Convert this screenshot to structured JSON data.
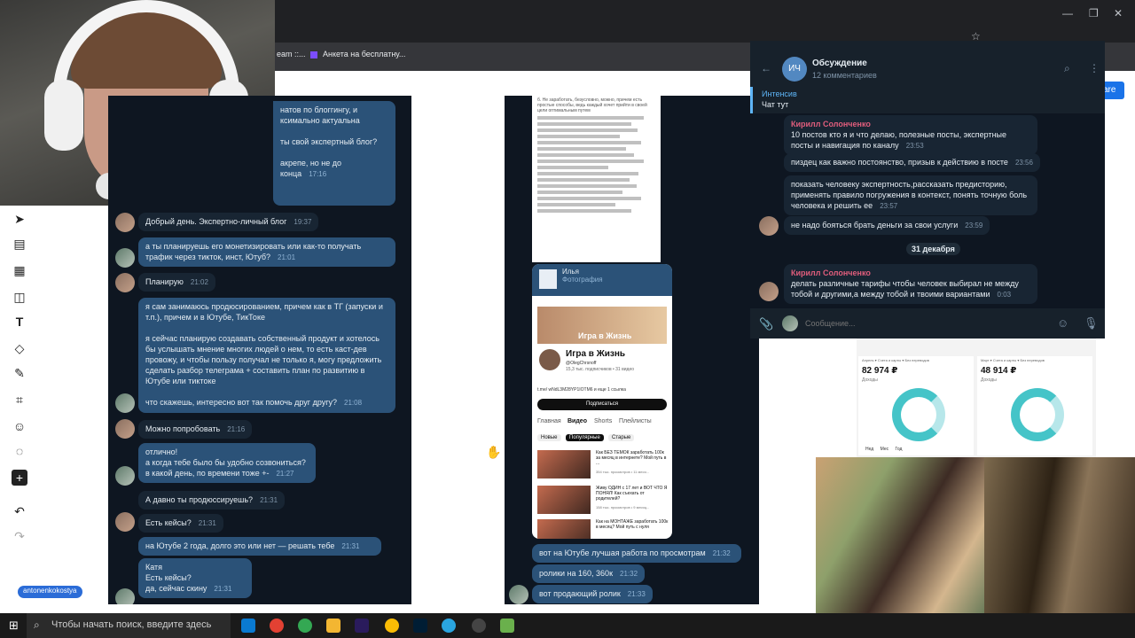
{
  "browser": {
    "bookmarks": [
      "eam ::...",
      "Анкета на бесплатну..."
    ],
    "share_label": "are"
  },
  "overlay": {
    "username": "antonenkokostya"
  },
  "chat1": {
    "messages": [
      {
        "text": "натов по блоггингу, и\nксимально актуальна\n\nты свой экспертный блог?\n\nакрепе, но не до конца",
        "time": "17:16",
        "dir": "out"
      },
      {
        "text": "Добрый день. Экспертно-личный блог",
        "time": "19:37",
        "dir": "in"
      },
      {
        "text": "а ты планируешь его монетизировать или как-то получать трафик через тикток, инст, Ютуб?",
        "time": "21:01",
        "dir": "out"
      },
      {
        "text": "Планирую",
        "time": "21:02",
        "dir": "in"
      },
      {
        "text": "я сам занимаюсь продюсированием, причем как в ТГ (запуски и т.п.), причем и в Ютубе, ТикТоке\n\nя сейчас планирую создавать собственный продукт и хотелось бы услышать мнение многих людей о нем, то есть каст-дев провожу, и чтобы пользу получал не только я, могу предложить сделать разбор телеграма + составить план по развитию в Ютубе или тиктоке\n\nчто скажешь, интересно вот так помочь друг другу?",
        "time": "21:08",
        "dir": "out"
      },
      {
        "text": "Можно попробовать",
        "time": "21:16",
        "dir": "in"
      },
      {
        "text": "отлично!\nа когда тебе было бы удобно созвониться?\nв какой день, по времени тоже +-",
        "time": "21:27",
        "dir": "out"
      },
      {
        "text": "А давно ты продюссируешь?",
        "time": "21:31",
        "dir": "in"
      },
      {
        "text": "Есть кейсы?",
        "time": "21:31",
        "dir": "in"
      },
      {
        "text": "на Ютубе 2 года, долго это или нет — решать тебе",
        "time": "21:31",
        "dir": "out"
      },
      {
        "text": "Катя\nЕсть кейсы?\nда, сейчас скину",
        "time": "21:31",
        "dir": "out"
      }
    ]
  },
  "chat2": {
    "doc_lines": "б. Не заработать, безусловно, можно, причем есть простые способы, ведь каждый хочет прийти в своей цели оптимальным путем",
    "forward_name": "Илья",
    "forward_sub": "Фотография",
    "yt": {
      "banner": "Игра в Жизнь",
      "channel": "Игра в Жизнь",
      "handle": "@OlegChrsnoff",
      "subs": "15,3 тыс. подписчиков • 31 видео",
      "link": "t.me/ wNdL3M28YP1IOTM6 и еще 1 ссылка",
      "subscribe": "Подписаться",
      "tabs": [
        "Главная",
        "Видео",
        "Shorts",
        "Плейлисты"
      ],
      "filters": [
        "Новые",
        "Популярные",
        "Старые"
      ],
      "videos": [
        {
          "title": "Как БЕЗ ТЕМОК заработать 100к за месяц в интернете? Мой путь в ...",
          "meta": "354 тыс. просмотров • 11 меся..."
        },
        {
          "title": "Живу ОДИН с 17 лет и ВОТ ЧТО Я ПОНЯЛ! Как съехать от родителей?",
          "meta": "158 тыс. просмотров • 9 месяц..."
        },
        {
          "title": "Как на МОНТАЖЕ заработать 100к в месяц? Мой путь с нуля",
          "meta": "..."
        }
      ]
    },
    "messages": [
      {
        "text": "вот на Ютубе лучшая работа по просмотрам",
        "time": "21:32"
      },
      {
        "text": "ролики на 160, 360к",
        "time": "21:32"
      },
      {
        "text": "вот продающий ролик",
        "time": "21:33"
      }
    ]
  },
  "discussion": {
    "avatar_initials": "ИЧ",
    "title": "Обсуждение",
    "subtitle": "12 комментариев",
    "pinned_title": "Интенсив",
    "pinned_text": "Чат тут",
    "messages": [
      {
        "name": "Кирилл Солонченко",
        "text": "10 постов кто я и что делаю, полезные посты, экспертные посты и навигация по каналу",
        "time": "23:53"
      },
      {
        "name": "",
        "text": "пиздец как важно постоянство, призыв к действию в посте",
        "time": "23:56"
      },
      {
        "name": "",
        "text": "показать человеку экспертность,рассказать предисторию, применять правило погружения в контекст, понять точную боль человека и решить ее",
        "time": "23:57"
      },
      {
        "name": "",
        "text": "не надо бояться брать деньги за свои услуги",
        "time": "23:59"
      },
      {
        "name": "Кирилл Солонченко",
        "text": "делать различные тарифы чтобы человек выбирал не между тобой и другими,а между тобой и твоими вариантами",
        "time": "0:03"
      }
    ],
    "date_sep": "31 декабря",
    "input_placeholder": "Сообщение..."
  },
  "bank": {
    "left_amount": "82 974 ₽",
    "right_amount": "48 914 ₽",
    "left_label": "Доходы",
    "right_label": "Доходы",
    "tabs_left": [
      "Апрель ▾",
      "Счета и карты ▾",
      "Без переводов"
    ],
    "tabs_right": [
      "Март ▾",
      "Счета и карты ▾",
      "Без переводов"
    ],
    "periods": [
      "Нед",
      "Мес",
      "Год"
    ]
  },
  "taskbar": {
    "search_placeholder": "Чтобы начать поиск, введите здесь"
  },
  "colors": {
    "tg_bg": "#0e1621",
    "tg_out": "#2b5278",
    "tg_in": "#182533",
    "accent": "#5eb5f7"
  }
}
